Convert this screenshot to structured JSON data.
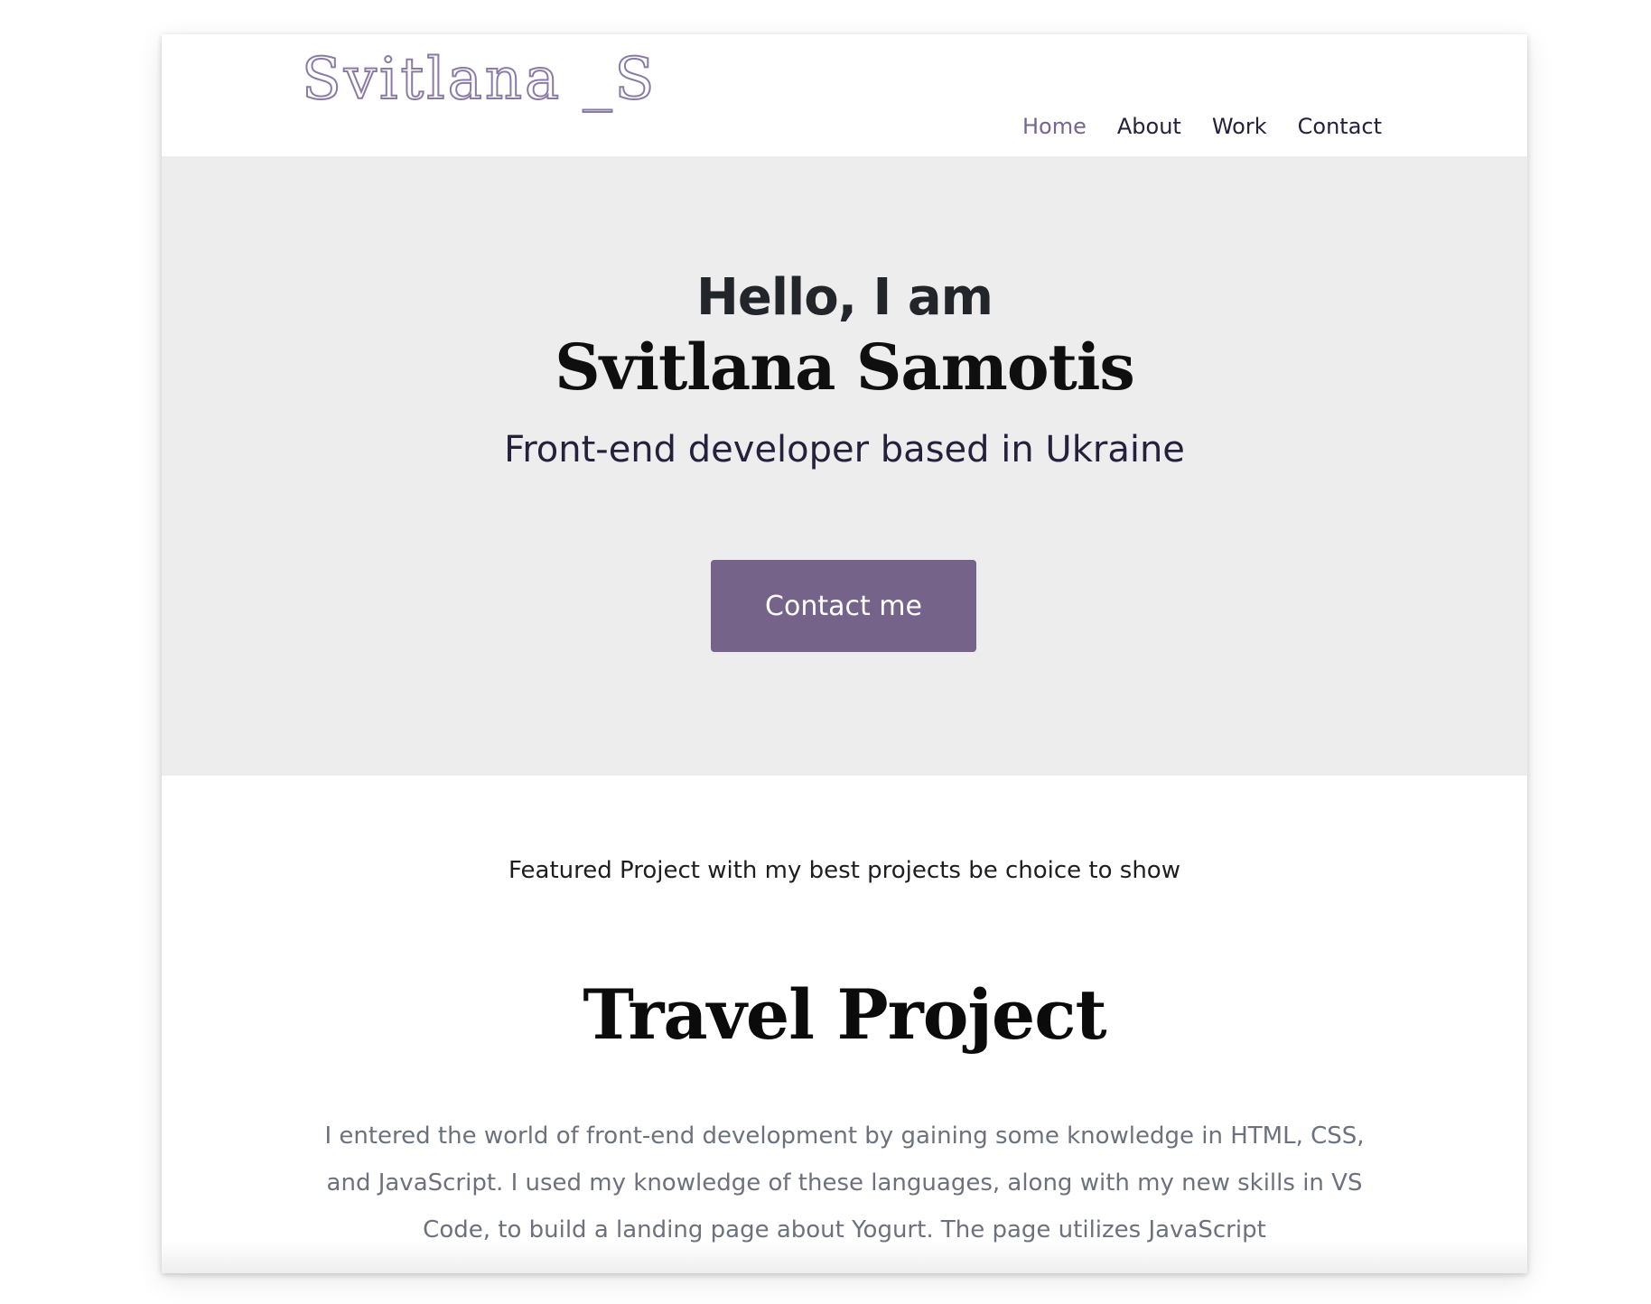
{
  "header": {
    "logo": "Svitlana _S",
    "nav": [
      {
        "label": "Home",
        "active": true
      },
      {
        "label": "About",
        "active": false
      },
      {
        "label": "Work",
        "active": false
      },
      {
        "label": "Contact",
        "active": false
      }
    ]
  },
  "hero": {
    "greeting": "Hello, I am",
    "name": "Svitlana Samotis",
    "subtitle": "Front-end developer based in Ukraine",
    "cta_label": "Contact me"
  },
  "featured": {
    "intro": "Featured Project with my best projects be choice to show",
    "project_title": "Travel Project",
    "project_description": "I entered the world of front-end development by gaining some knowledge in HTML, CSS, and JavaScript. I used my knowledge of these languages, along with my new skills in VS Code, to build a landing page about Yogurt. The page utilizes JavaScript"
  },
  "colors": {
    "accent": "#766389",
    "nav_active": "#76658f",
    "nav_text": "#25203c",
    "hero_bg": "#ededed",
    "body_text": "#6c727d"
  }
}
